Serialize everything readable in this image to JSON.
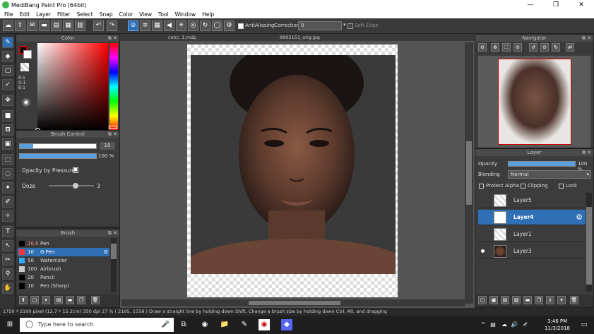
{
  "window": {
    "title": "MediBang Paint Pro (64bit)",
    "minimize": "—",
    "restore": "❐",
    "close": "✕"
  },
  "menu": [
    "File",
    "Edit",
    "Layer",
    "Filter",
    "Select",
    "Snap",
    "Color",
    "View",
    "Tool",
    "Window",
    "Help"
  ],
  "toolbar": {
    "antialiasing_label": "AntiAliasing",
    "correction_label": "Correction",
    "correction_value": "0",
    "soft_edge_label": "Soft Edge"
  },
  "tabs": {
    "file1": "conc. 1.mdp",
    "file2": "9905151_orig.jpg"
  },
  "color_panel": {
    "title": "Color",
    "r": "R:1",
    "g": "G:1",
    "b": "B:1",
    "foreground": "#000000",
    "accent": "#cc0000"
  },
  "brush_control": {
    "title": "Brush Control",
    "size_value": "10",
    "opacity_value": "100 %",
    "opacity_by_pressure": "Opacity by Pressure",
    "ooze_label": "Ooze",
    "ooze_value": "3"
  },
  "brush_list": {
    "title": "Brush",
    "items": [
      {
        "size": "16.6",
        "name": "Pen",
        "color": "#000000"
      },
      {
        "size": "10",
        "name": "G Pen",
        "color": "#ff3333"
      },
      {
        "size": "50",
        "name": "Watercolor",
        "color": "#33aaff"
      },
      {
        "size": "100",
        "name": "Airbrush",
        "color": "#cccccc"
      },
      {
        "size": "20",
        "name": "Pencil",
        "color": "#000000"
      },
      {
        "size": "10",
        "name": "Pen (Sharp)",
        "color": "#000000"
      }
    ]
  },
  "navigator": {
    "title": "Navigator"
  },
  "layer_panel": {
    "title": "Layer",
    "opacity_label": "Opacity",
    "opacity_value": "100 %",
    "opacity_level": 1.0,
    "blending_label": "Blending",
    "blending_value": "Normal",
    "protect_alpha": "Protect Alpha",
    "clipping": "Clipping",
    "lock": "Lock",
    "layers": [
      {
        "name": "Layer5",
        "selected": false,
        "visible": false
      },
      {
        "name": "Layer4",
        "selected": true,
        "visible": false
      },
      {
        "name": "Layer1",
        "selected": false,
        "visible": false
      },
      {
        "name": "Layer3",
        "selected": false,
        "visible": true
      }
    ]
  },
  "status": {
    "text": "1750 * 2100 pixel  (12.7 * 15.2cm)  350 dpi  27 %  ( 2195, 1558 )  Draw a straight line by holding down Shift, Change a brush size by holding down Ctrl, Alt, and dragging"
  },
  "taskbar": {
    "search_placeholder": "Type here to search",
    "time": "3:46 PM",
    "date": "11/3/2018"
  }
}
